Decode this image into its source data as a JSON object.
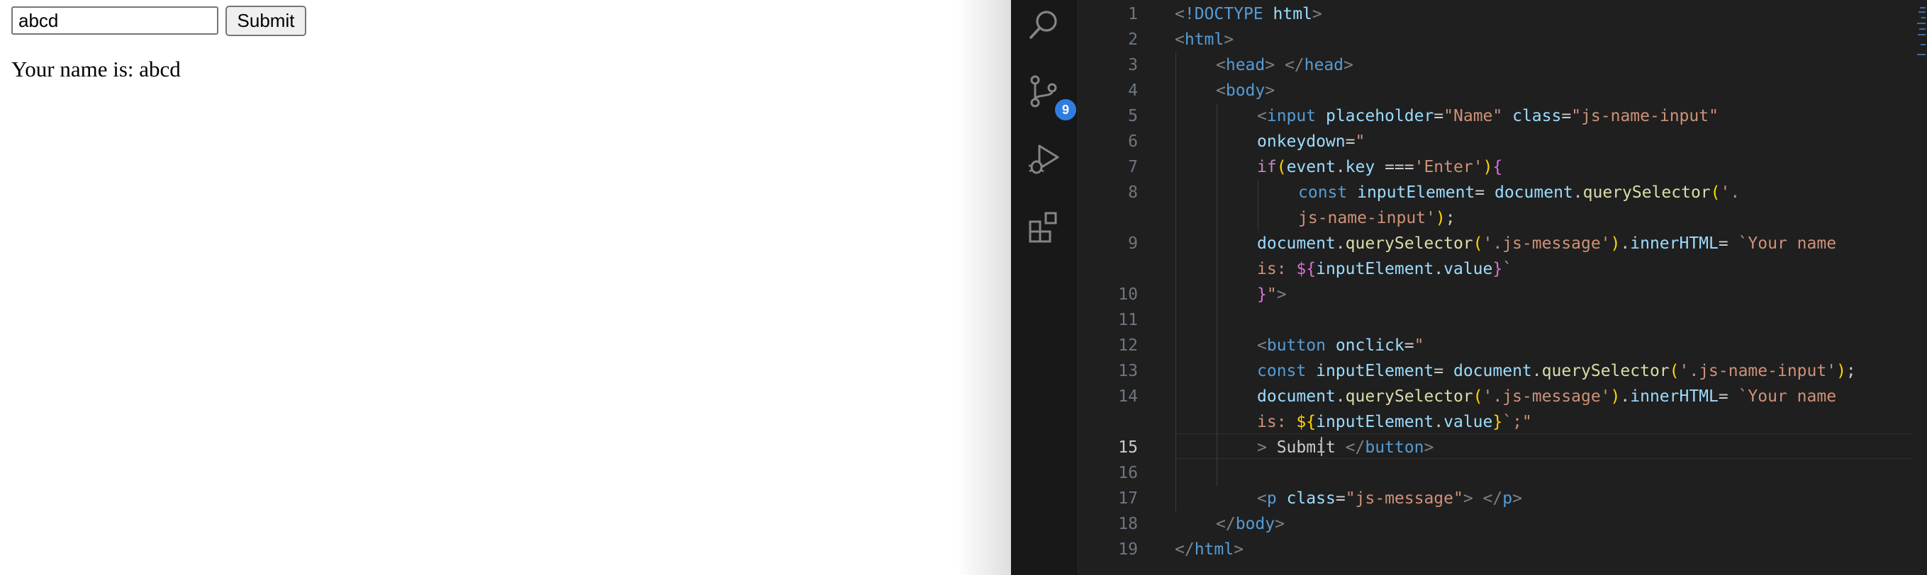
{
  "browser": {
    "input_value": "abcd",
    "input_placeholder": "Name",
    "submit_label": "Submit",
    "message": "Your name is: abcd"
  },
  "activity_bar": {
    "icons": [
      "search-icon",
      "source-control-icon",
      "run-debug-icon",
      "extensions-icon"
    ],
    "source_control_badge": "9"
  },
  "editor": {
    "active_line": 15,
    "line_numbers": [
      "1",
      "2",
      "3",
      "4",
      "5",
      "6",
      "7",
      "8",
      "9",
      "10",
      "11",
      "12",
      "13",
      "14",
      "15",
      "16",
      "17",
      "18",
      "19"
    ],
    "lines": [
      {
        "n": "1",
        "tokens": [
          [
            "brk",
            "<"
          ],
          [
            "dkw",
            "!DOCTYPE"
          ],
          [
            "txt",
            " "
          ],
          [
            "att",
            "html"
          ],
          [
            "brk",
            ">"
          ]
        ]
      },
      {
        "n": "2",
        "tokens": [
          [
            "brk",
            "<"
          ],
          [
            "tag",
            "html"
          ],
          [
            "brk",
            ">"
          ]
        ]
      },
      {
        "n": "3",
        "tokens": [
          [
            "brk",
            "<"
          ],
          [
            "tag",
            "head"
          ],
          [
            "brk",
            "> </"
          ],
          [
            "tag",
            "head"
          ],
          [
            "brk",
            ">"
          ]
        ]
      },
      {
        "n": "4",
        "tokens": [
          [
            "brk",
            "<"
          ],
          [
            "tag",
            "body"
          ],
          [
            "brk",
            ">"
          ]
        ]
      },
      {
        "n": "5",
        "tokens": [
          [
            "brk",
            "<"
          ],
          [
            "tag",
            "input"
          ],
          [
            "txt",
            " "
          ],
          [
            "att",
            "placeholder"
          ],
          [
            "txt",
            "="
          ],
          [
            "str",
            "\"Name\""
          ],
          [
            "txt",
            " "
          ],
          [
            "att",
            "class"
          ],
          [
            "txt",
            "="
          ],
          [
            "str",
            "\"js-name-input\""
          ]
        ]
      },
      {
        "n": "6",
        "tokens": [
          [
            "att",
            "onkeydown"
          ],
          [
            "txt",
            "="
          ],
          [
            "str",
            "\""
          ]
        ]
      },
      {
        "n": "7",
        "tokens": [
          [
            "kw",
            "if"
          ],
          [
            "y",
            "("
          ],
          [
            "var",
            "event"
          ],
          [
            "txt",
            "."
          ],
          [
            "var",
            "key"
          ],
          [
            "txt",
            " ==="
          ],
          [
            "str",
            "'Enter'"
          ],
          [
            "y",
            ")"
          ],
          [
            "m",
            "{"
          ]
        ]
      },
      {
        "n": "8",
        "tokens": [
          [
            "dkw",
            "const"
          ],
          [
            "txt",
            " "
          ],
          [
            "var",
            "inputElement"
          ],
          [
            "txt",
            "= "
          ],
          [
            "var",
            "document"
          ],
          [
            "txt",
            "."
          ],
          [
            "fn",
            "querySelector"
          ],
          [
            "y",
            "("
          ],
          [
            "str",
            "'."
          ]
        ]
      },
      {
        "n": "",
        "tokens": [
          [
            "str",
            "js-name-input'"
          ],
          [
            "y",
            ")"
          ],
          [
            "txt",
            ";"
          ]
        ]
      },
      {
        "n": "9",
        "tokens": [
          [
            "var",
            "document"
          ],
          [
            "txt",
            "."
          ],
          [
            "fn",
            "querySelector"
          ],
          [
            "y",
            "("
          ],
          [
            "str",
            "'.js-message'"
          ],
          [
            "y",
            ")"
          ],
          [
            "txt",
            "."
          ],
          [
            "var",
            "innerHTML"
          ],
          [
            "txt",
            "= "
          ],
          [
            "str",
            "`Your name"
          ]
        ]
      },
      {
        "n": "",
        "tokens": [
          [
            "str",
            "is: "
          ],
          [
            "m",
            "${"
          ],
          [
            "var",
            "inputElement"
          ],
          [
            "txt",
            "."
          ],
          [
            "var",
            "value"
          ],
          [
            "m",
            "}"
          ],
          [
            "str",
            "`"
          ]
        ]
      },
      {
        "n": "10",
        "tokens": [
          [
            "m",
            "}"
          ],
          [
            "str",
            "\""
          ],
          [
            "brk",
            ">"
          ]
        ]
      },
      {
        "n": "11",
        "tokens": []
      },
      {
        "n": "12",
        "tokens": [
          [
            "brk",
            "<"
          ],
          [
            "tag",
            "button"
          ],
          [
            "txt",
            " "
          ],
          [
            "att",
            "onclick"
          ],
          [
            "txt",
            "="
          ],
          [
            "str",
            "\""
          ]
        ]
      },
      {
        "n": "13",
        "tokens": [
          [
            "dkw",
            "const"
          ],
          [
            "txt",
            " "
          ],
          [
            "var",
            "inputElement"
          ],
          [
            "txt",
            "= "
          ],
          [
            "var",
            "document"
          ],
          [
            "txt",
            "."
          ],
          [
            "fn",
            "querySelector"
          ],
          [
            "y",
            "("
          ],
          [
            "str",
            "'.js-name-input'"
          ],
          [
            "y",
            ")"
          ],
          [
            "txt",
            ";"
          ]
        ]
      },
      {
        "n": "14",
        "tokens": [
          [
            "var",
            "document"
          ],
          [
            "txt",
            "."
          ],
          [
            "fn",
            "querySelector"
          ],
          [
            "y",
            "("
          ],
          [
            "str",
            "'.js-message'"
          ],
          [
            "y",
            ")"
          ],
          [
            "txt",
            "."
          ],
          [
            "var",
            "innerHTML"
          ],
          [
            "txt",
            "= "
          ],
          [
            "str",
            "`Your name"
          ]
        ]
      },
      {
        "n": "",
        "tokens": [
          [
            "str",
            "is: "
          ],
          [
            "y",
            "${"
          ],
          [
            "var",
            "inputElement"
          ],
          [
            "txt",
            "."
          ],
          [
            "var",
            "value"
          ],
          [
            "y",
            "}"
          ],
          [
            "str",
            "`;\""
          ]
        ]
      },
      {
        "n": "15",
        "tokens": [
          [
            "brk",
            ">"
          ],
          [
            "txt",
            " Submit "
          ],
          [
            "brk",
            "</"
          ],
          [
            "tag",
            "button"
          ],
          [
            "brk",
            ">"
          ]
        ]
      },
      {
        "n": "16",
        "tokens": []
      },
      {
        "n": "17",
        "tokens": [
          [
            "brk",
            "<"
          ],
          [
            "tag",
            "p"
          ],
          [
            "txt",
            " "
          ],
          [
            "att",
            "class"
          ],
          [
            "txt",
            "="
          ],
          [
            "str",
            "\"js-message\""
          ],
          [
            "brk",
            "> </"
          ],
          [
            "tag",
            "p"
          ],
          [
            "brk",
            ">"
          ]
        ]
      },
      {
        "n": "18",
        "tokens": [
          [
            "brk",
            "</"
          ],
          [
            "tag",
            "body"
          ],
          [
            "brk",
            ">"
          ]
        ]
      },
      {
        "n": "19",
        "tokens": [
          [
            "brk",
            "</"
          ],
          [
            "tag",
            "html"
          ],
          [
            "brk",
            ">"
          ]
        ]
      }
    ]
  }
}
